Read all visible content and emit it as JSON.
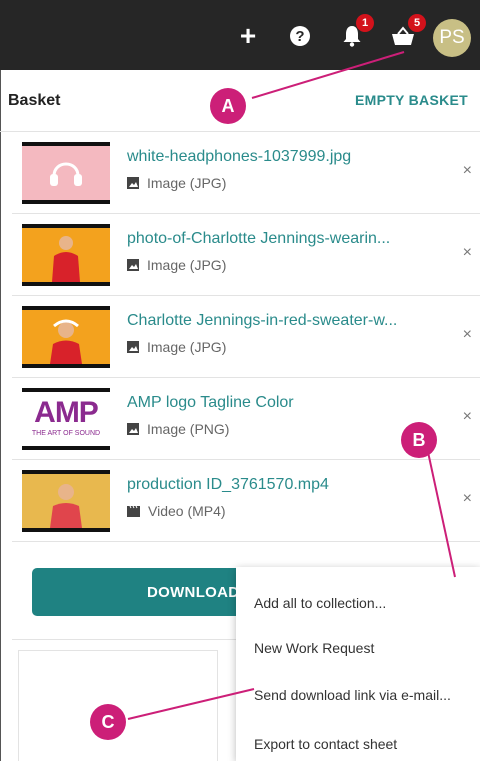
{
  "topbar": {
    "bell_count": "1",
    "basket_count": "5",
    "avatar_initials": "PS"
  },
  "basket": {
    "title": "Basket",
    "empty_label": "EMPTY BASKET",
    "items": [
      {
        "name": "white-headphones-1037999.jpg",
        "type": "Image (JPG)",
        "type_icon": "image-icon"
      },
      {
        "name": "photo-of-Charlotte Jennings-wearin...",
        "type": "Image (JPG)",
        "type_icon": "image-icon"
      },
      {
        "name": "Charlotte Jennings-in-red-sweater-w...",
        "type": "Image (JPG)",
        "type_icon": "image-icon"
      },
      {
        "name": "AMP logo Tagline Color",
        "type": "Image (PNG)",
        "type_icon": "image-icon"
      },
      {
        "name": "production ID_3761570.mp4",
        "type": "Video (MP4)",
        "type_icon": "video-icon"
      }
    ],
    "close_glyph": "×",
    "download_label": "DOWNLOAD"
  },
  "amp_logo": {
    "text": "AMP",
    "tagline": "THE ART OF SOUND"
  },
  "menu": {
    "items": [
      "Add all to collection...",
      "New Work Request",
      "Send download link via e-mail...",
      "Export to contact sheet"
    ]
  },
  "callouts": {
    "a": "A",
    "b": "B",
    "c": "C"
  },
  "colors": {
    "accent": "#2a8b8b",
    "button": "#1f8282",
    "badge": "#d3121b",
    "callout": "#cc1f78",
    "topbar": "#262626"
  }
}
